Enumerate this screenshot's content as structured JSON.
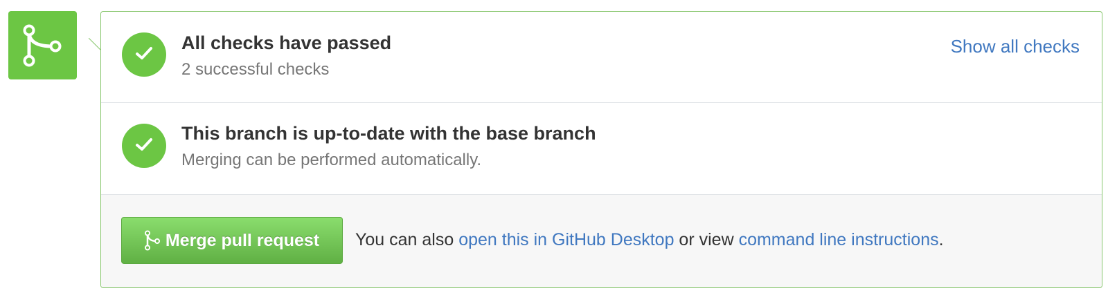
{
  "colors": {
    "success_green": "#6cc644",
    "panel_border": "#86c66b",
    "link_blue": "#4078c0",
    "muted_text": "#767676",
    "merge_area_bg": "#f7f7f7"
  },
  "merge_badge": {
    "icon": "git-merge-icon"
  },
  "checks": {
    "icon": "check-icon",
    "title": "All checks have passed",
    "subtitle": "2 successful checks",
    "show_all_label": "Show all checks"
  },
  "branch": {
    "icon": "check-icon",
    "title": "This branch is up-to-date with the base branch",
    "subtitle": "Merging can be performed automatically."
  },
  "merge": {
    "button_icon": "git-merge-icon",
    "button_label": "Merge pull request",
    "text_before": "You can also ",
    "desktop_link": "open this in GitHub Desktop",
    "text_middle": " or view ",
    "cli_link": "command line instructions",
    "text_after": "."
  }
}
